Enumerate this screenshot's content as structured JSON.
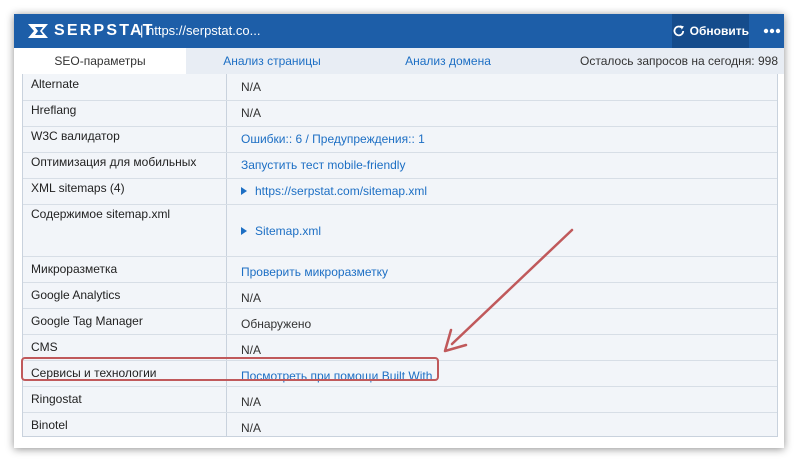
{
  "header": {
    "logo_text": "SERPSTAT",
    "url": "| https://serpstat.co...",
    "refresh_label": "Обновить",
    "more_icon": "more-horizontal-icon"
  },
  "tabs": [
    {
      "label": "SEO-параметры",
      "active": true
    },
    {
      "label": "Анализ страницы",
      "active": false
    },
    {
      "label": "Анализ домена",
      "active": false
    }
  ],
  "quota_text": "Осталось запросов на сегодня: 998",
  "rows": [
    {
      "label": "Alternate",
      "value": "N/A",
      "link": false
    },
    {
      "label": "Hreflang",
      "value": "N/A",
      "link": false
    },
    {
      "label": "W3C валидатор",
      "value": "Ошибки:: 6 / Предупреждения:: 1",
      "link": true
    },
    {
      "label": "Оптимизация для мобильных",
      "value": "Запустить тест mobile-friendly",
      "link": true
    },
    {
      "label": "XML sitemaps (4)",
      "value": "https://serpstat.com/sitemap.xml",
      "link": true,
      "expander": true
    },
    {
      "label": "Содержимое sitemap.xml",
      "value": "Sitemap.xml",
      "link": true,
      "expander": true
    },
    {
      "label": "Микроразметка",
      "value": "Проверить микроразметку",
      "link": true
    },
    {
      "label": "Google Analytics",
      "value": "N/A",
      "link": false
    },
    {
      "label": "Google Tag Manager",
      "value": "Обнаружено",
      "link": false
    },
    {
      "label": "CMS",
      "value": "N/A",
      "link": false
    },
    {
      "label": "Сервисы и технологии",
      "value": "Посмотреть при помощи Built With",
      "link": true
    },
    {
      "label": "Ringostat",
      "value": "N/A",
      "link": false
    },
    {
      "label": "Binotel",
      "value": "N/A",
      "link": false
    }
  ],
  "colors": {
    "header_bg": "#1d5ea8",
    "link": "#1d6fc4",
    "annotation": "#c0595b"
  }
}
